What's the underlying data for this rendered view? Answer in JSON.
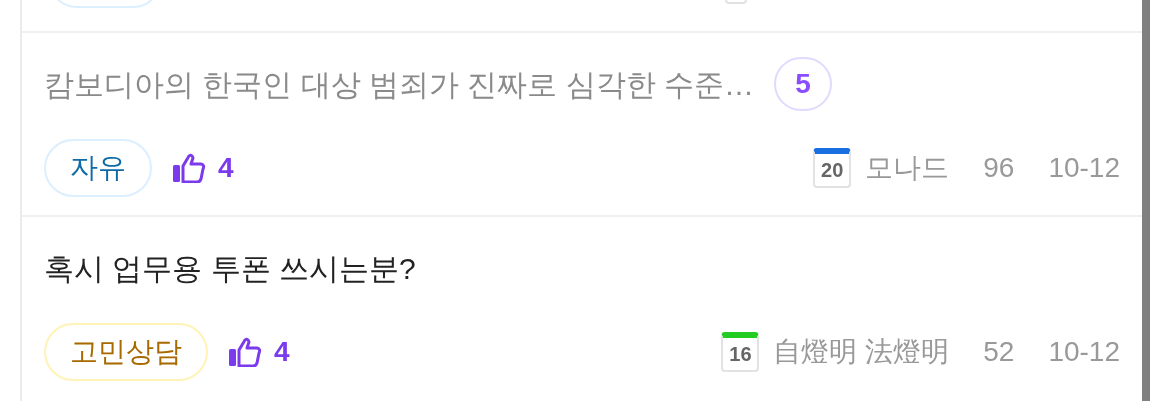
{
  "posts": [
    {
      "title": "캄보디아의 한국인 대상 범죄가 진짜로 심각한 수준…",
      "read": true,
      "comments": "5",
      "tag": {
        "label": "자유",
        "color": "#0f6aa6"
      },
      "likes": "4",
      "level": {
        "label": "20",
        "color": "#1a6fe0"
      },
      "author": "모나드",
      "views": "96",
      "date": "10-12"
    },
    {
      "title": "혹시 업무용 투폰 쓰시는분?",
      "read": false,
      "tag": {
        "label": "고민상담",
        "color": "#a86a00"
      },
      "likes": "4",
      "level": {
        "label": "16",
        "color": "#22cc22"
      },
      "author": "自燈明 法燈明",
      "views": "52",
      "date": "10-12"
    }
  ]
}
